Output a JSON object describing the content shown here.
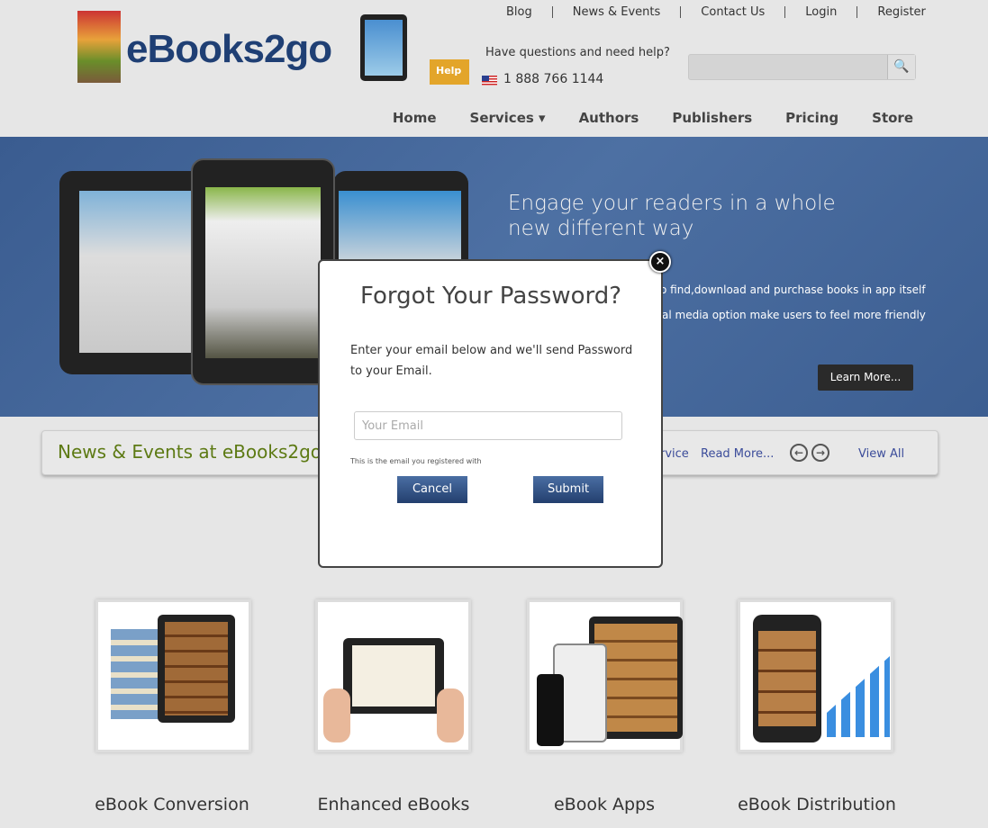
{
  "top_links": [
    "Blog",
    "News & Events",
    "Contact Us",
    "Login",
    "Register"
  ],
  "logo": {
    "text": "eBooks2go"
  },
  "help": {
    "badge": "Help",
    "question": "Have questions and need help?",
    "phone": "1 888 766 1144"
  },
  "search": {
    "placeholder": "",
    "icon": "search-icon"
  },
  "nav": [
    "Home",
    "Services ▾",
    "Authors",
    "Publishers",
    "Pricing",
    "Store"
  ],
  "hero": {
    "title": "Engage your readers in a whole new different way",
    "features": [
      "o find,download and purchase books in app itself",
      "al media option make users to feel more friendly"
    ],
    "cta": "Learn More..."
  },
  "news": {
    "title": "News & Events at eBooks2go:",
    "snippet": "rvice",
    "read_more": "Read More...",
    "view_all": "View All"
  },
  "services": [
    "eBook Conversion",
    "Enhanced eBooks",
    "eBook Apps",
    "eBook Distribution"
  ],
  "modal": {
    "title": "Forgot Your Password?",
    "description": "Enter your email below and we'll send Password to your Email.",
    "email_placeholder": "Your Email",
    "hint": "This is the email you registered with",
    "cancel": "Cancel",
    "submit": "Submit",
    "close": "×"
  }
}
